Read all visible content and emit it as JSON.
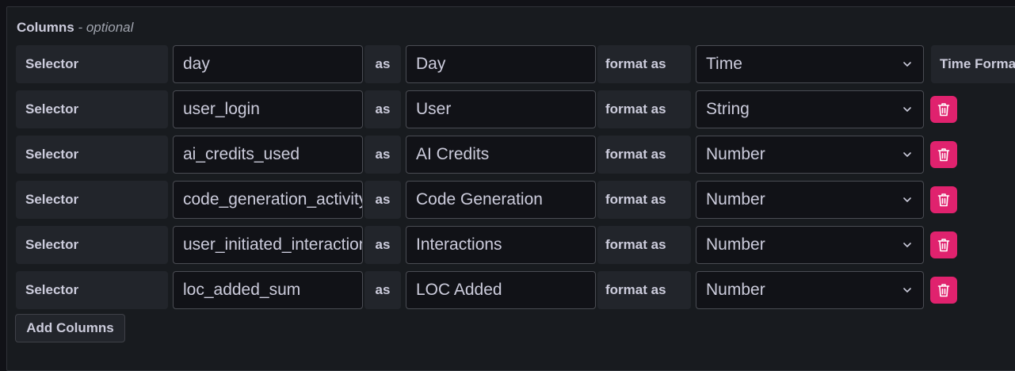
{
  "section": {
    "title": "Columns",
    "optional_label": "- optional"
  },
  "labels": {
    "selector": "Selector",
    "as": "as",
    "format_as": "format as",
    "time_format": "Time Forma"
  },
  "rows": [
    {
      "selector": "day",
      "alias": "Day",
      "format": "Time",
      "deletable": false
    },
    {
      "selector": "user_login",
      "alias": "User",
      "format": "String",
      "deletable": true
    },
    {
      "selector": "ai_credits_used",
      "alias": "AI Credits",
      "format": "Number",
      "deletable": true
    },
    {
      "selector": "code_generation_activity_count",
      "alias": "Code Generation",
      "format": "Number",
      "deletable": true
    },
    {
      "selector": "user_initiated_interaction_count",
      "alias": "Interactions",
      "format": "Number",
      "deletable": true
    },
    {
      "selector": "loc_added_sum",
      "alias": "LOC Added",
      "format": "Number",
      "deletable": true
    }
  ],
  "buttons": {
    "add_columns": "Add Columns"
  },
  "colors": {
    "danger": "#e0226e",
    "text": "#ccccdc",
    "panel_bg": "#181b1f",
    "label_bg": "#22252b",
    "input_bg": "#111217",
    "input_border": "#4a4c53"
  },
  "icons": {
    "dropdown": "chevron-down-icon",
    "delete": "trash-icon"
  }
}
